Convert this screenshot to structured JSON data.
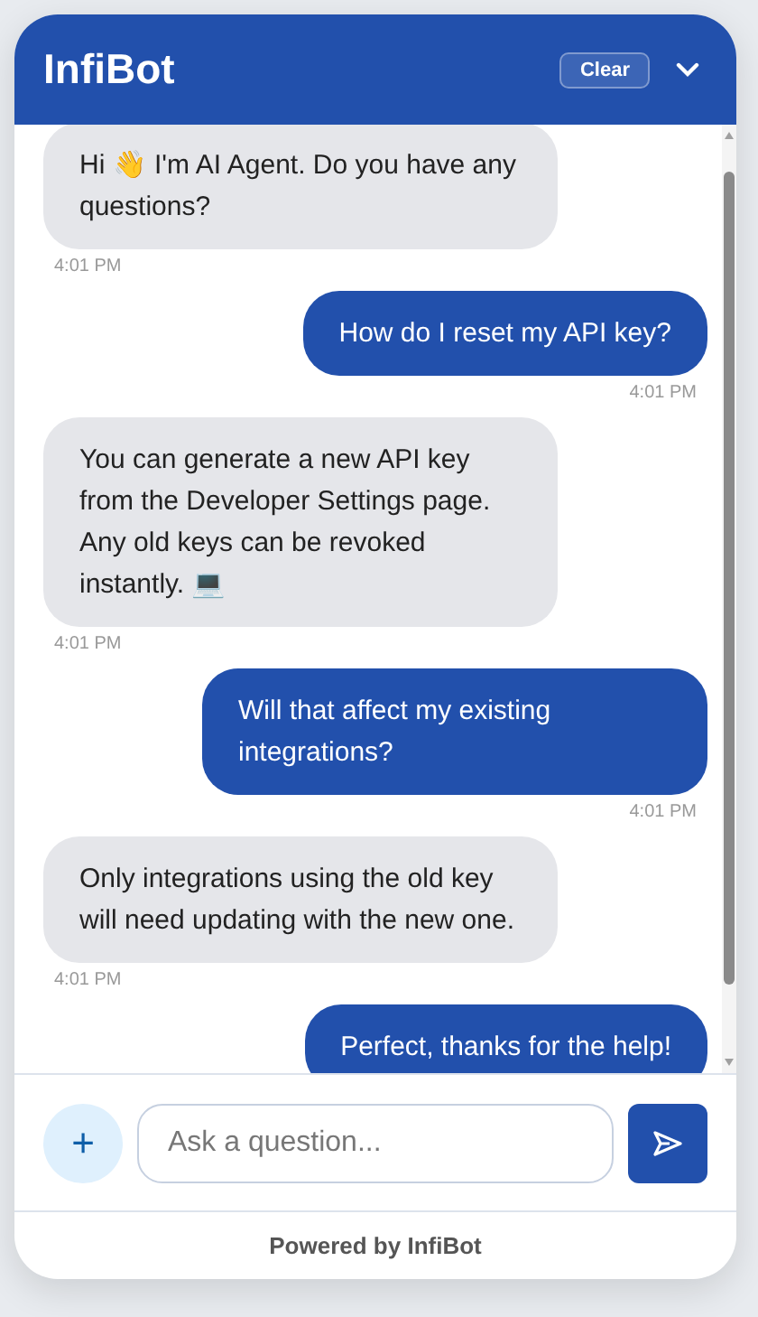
{
  "header": {
    "title": "InfiBot",
    "clear_button": "Clear"
  },
  "messages": [
    {
      "kind": "bot",
      "text": "Hi 👋 I'm AI Agent. Do you have any questions?",
      "time": "4:01 PM"
    },
    {
      "kind": "user",
      "text": "How do I reset my API key?",
      "time": "4:01 PM"
    },
    {
      "kind": "bot",
      "text": "You can generate a new API key from the Developer Settings page. Any old keys can be revoked instantly. 💻",
      "time": "4:01 PM"
    },
    {
      "kind": "user",
      "text": "Will that affect my existing integrations?",
      "time": "4:01 PM"
    },
    {
      "kind": "bot",
      "text": "Only integrations using the old key will need updating with the new one.",
      "time": "4:01 PM"
    },
    {
      "kind": "user",
      "text": "Perfect, thanks for the help!"
    }
  ],
  "composer": {
    "placeholder": "Ask a question...",
    "add_button": "+"
  },
  "footer": "Powered by InfiBot"
}
